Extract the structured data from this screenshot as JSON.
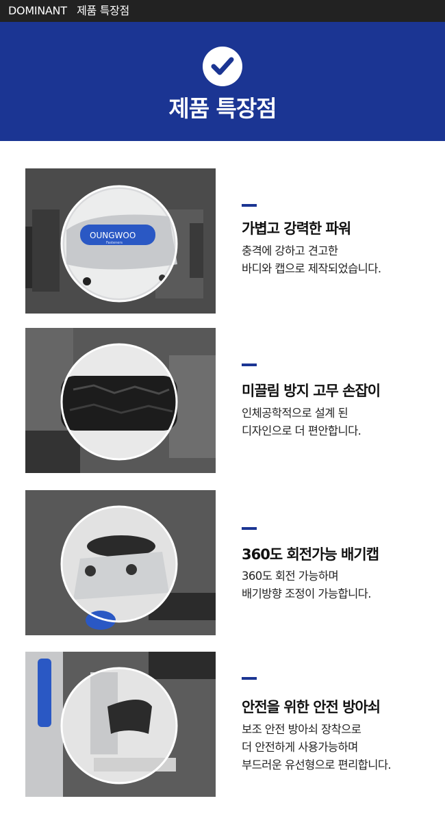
{
  "topbar": {
    "brand": "DOMINANT",
    "title": "제품 특장점"
  },
  "hero": {
    "icon": "checkmark-icon",
    "title": "제품 특장점",
    "colors": {
      "background": "#1b3593",
      "accent": "#1b3593"
    }
  },
  "features": [
    {
      "title": "가볍고 강력한 파워",
      "lines": [
        "충격에 강하고 견고한",
        "바디와 캡으로 제작되었습니다."
      ],
      "photo_logo": "OUNGWOO",
      "photo_logo_sub": "Fasteners"
    },
    {
      "title": "미끌림 방지 고무 손잡이",
      "lines": [
        "인체공학적으로 설계 된",
        "디자인으로 더 편안합니다."
      ]
    },
    {
      "title": "360도 회전가능 배기캡",
      "lines": [
        "360도 회전 가능하며",
        "배기방향 조정이 가능합니다."
      ]
    },
    {
      "title": "안전을 위한 안전 방아쇠",
      "lines": [
        "보조 안전 방아쇠 장착으로",
        "더 안전하게 사용가능하며",
        "부드러운 유선형으로 편리합니다."
      ]
    }
  ]
}
